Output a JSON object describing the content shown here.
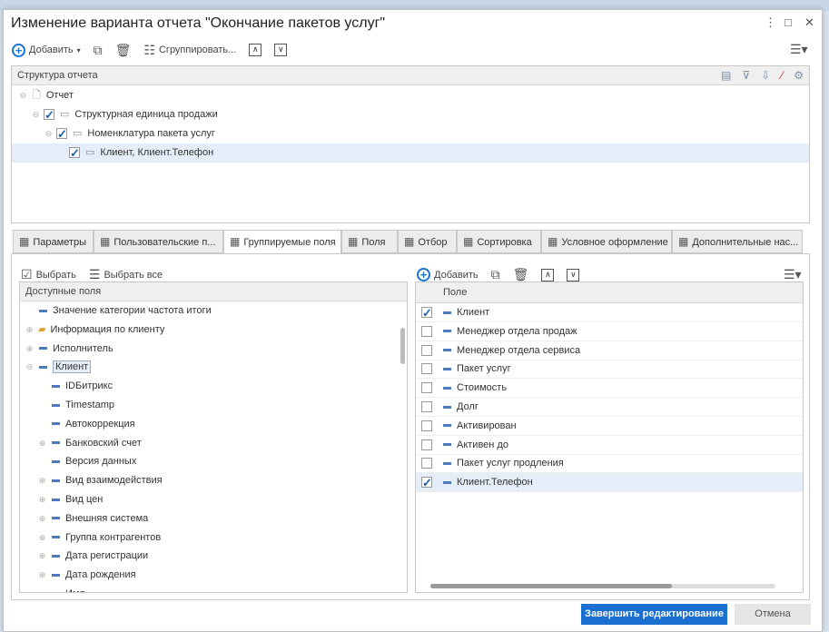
{
  "dialog": {
    "title": "Изменение варианта отчета \"Окончание пакетов услуг\"",
    "more": "⋮",
    "maximize": "□",
    "close": "✕"
  },
  "toolbar": {
    "add": "Добавить",
    "add_arrow": "▾",
    "group": "Сгруппировать...",
    "menu": "☰▾"
  },
  "structure": {
    "header": "Структура отчета",
    "rows": [
      {
        "label": "Отчет",
        "level": 0,
        "checkbox": false,
        "checked": false
      },
      {
        "label": "Структурная единица продажи",
        "level": 1,
        "checkbox": true,
        "checked": true
      },
      {
        "label": "Номенклатура пакета услуг",
        "level": 2,
        "checkbox": true,
        "checked": true
      },
      {
        "label": "Клиент, Клиент.Телефон",
        "level": 3,
        "checkbox": true,
        "checked": true,
        "selected": true
      }
    ]
  },
  "tabs": [
    {
      "label": "Параметры",
      "icon": "table-plus-icon"
    },
    {
      "label": "Пользовательские п...",
      "icon": "table-user-icon"
    },
    {
      "label": "Группируемые поля",
      "icon": "grouping-icon",
      "active": true
    },
    {
      "label": "Поля",
      "icon": "list-icon"
    },
    {
      "label": "Отбор",
      "icon": "filter-icon"
    },
    {
      "label": "Сортировка",
      "icon": "sort-icon"
    },
    {
      "label": "Условное оформление",
      "icon": "format-icon"
    },
    {
      "label": "Дополнительные нас...",
      "icon": "settings-icon"
    }
  ],
  "left": {
    "select": "Выбрать",
    "select_all": "Выбрать все",
    "header": "Доступные поля",
    "items": [
      {
        "label": "Значение категории частота итоги",
        "level": 0,
        "expand": ""
      },
      {
        "label": "Информация по клиенту",
        "level": 0,
        "expand": "⊕",
        "folder": true
      },
      {
        "label": "Исполнитель",
        "level": 0,
        "expand": "⊕"
      },
      {
        "label": "Клиент",
        "level": 0,
        "expand": "⊖",
        "selected": true
      },
      {
        "label": "IDБитрикс",
        "level": 1,
        "expand": ""
      },
      {
        "label": "Timestamp",
        "level": 1,
        "expand": ""
      },
      {
        "label": "Автокоррекция",
        "level": 1,
        "expand": ""
      },
      {
        "label": "Банковский счет",
        "level": 1,
        "expand": "⊕"
      },
      {
        "label": "Версия данных",
        "level": 1,
        "expand": ""
      },
      {
        "label": "Вид взаимодействия",
        "level": 1,
        "expand": "⊕"
      },
      {
        "label": "Вид цен",
        "level": 1,
        "expand": "⊕"
      },
      {
        "label": "Внешняя система",
        "level": 1,
        "expand": "⊕"
      },
      {
        "label": "Группа контрагентов",
        "level": 1,
        "expand": "⊕"
      },
      {
        "label": "Дата регистрации",
        "level": 1,
        "expand": "⊕"
      },
      {
        "label": "Дата рождения",
        "level": 1,
        "expand": "⊕"
      },
      {
        "label": "Имя",
        "level": 1,
        "expand": ""
      }
    ]
  },
  "right": {
    "add": "Добавить",
    "header": "Поле",
    "menu": "☰▾",
    "items": [
      {
        "label": "Клиент",
        "checked": true
      },
      {
        "label": "Менеджер отдела продаж",
        "checked": false
      },
      {
        "label": "Менеджер отдела сервиса",
        "checked": false
      },
      {
        "label": "Пакет услуг",
        "checked": false
      },
      {
        "label": "Стоимость",
        "checked": false
      },
      {
        "label": "Долг",
        "checked": false
      },
      {
        "label": "Активирован",
        "checked": false
      },
      {
        "label": "Активен до",
        "checked": false
      },
      {
        "label": "Пакет услуг продления",
        "checked": false
      },
      {
        "label": "Клиент.Телефон",
        "checked": true,
        "selected": true
      }
    ]
  },
  "footer": {
    "finish": "Завершить редактирование",
    "cancel": "Отмена"
  },
  "colors": {
    "accent": "#1a73d6",
    "primary_button": "#1a6fd0",
    "selection": "#e4edf8"
  }
}
